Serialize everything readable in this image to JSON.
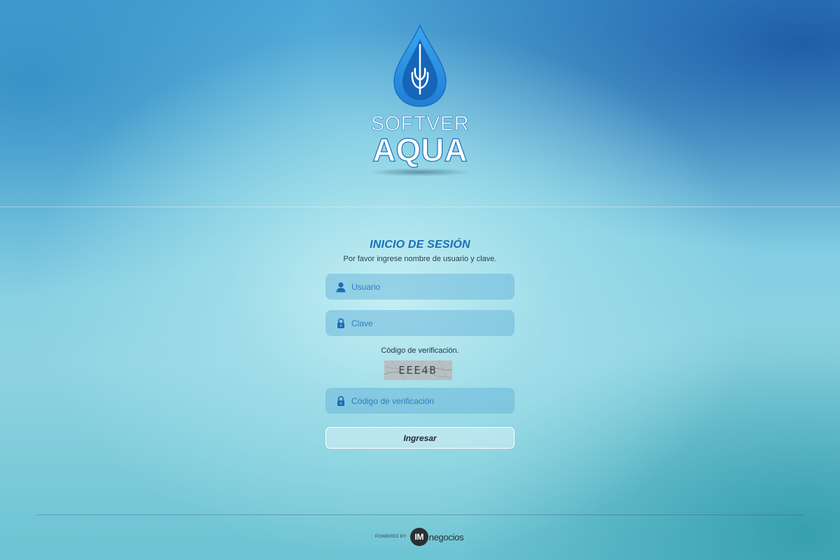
{
  "brand": {
    "line1": "SOFTVER",
    "line2": "AQUA"
  },
  "login": {
    "title": "INICIO DE SESIÓN",
    "subtitle": "Por favor ingrese nombre de usuario y clave.",
    "user_placeholder": "Usuario",
    "password_placeholder": "Clave",
    "captcha_label": "Código de verificación.",
    "captcha_text": "EEE4B",
    "code_placeholder": "Código de verificación",
    "submit_label": "Ingresar"
  },
  "footer": {
    "powered_by": "POWERED BY",
    "im": "IM",
    "company": "negocios"
  },
  "colors": {
    "accent": "#1a6fb5",
    "drop_outer": "#2a8fe0",
    "drop_inner": "#1b6fc2",
    "field_bg": "#5fafd7"
  },
  "icons": [
    "user-icon",
    "lock-icon",
    "lock-icon"
  ]
}
